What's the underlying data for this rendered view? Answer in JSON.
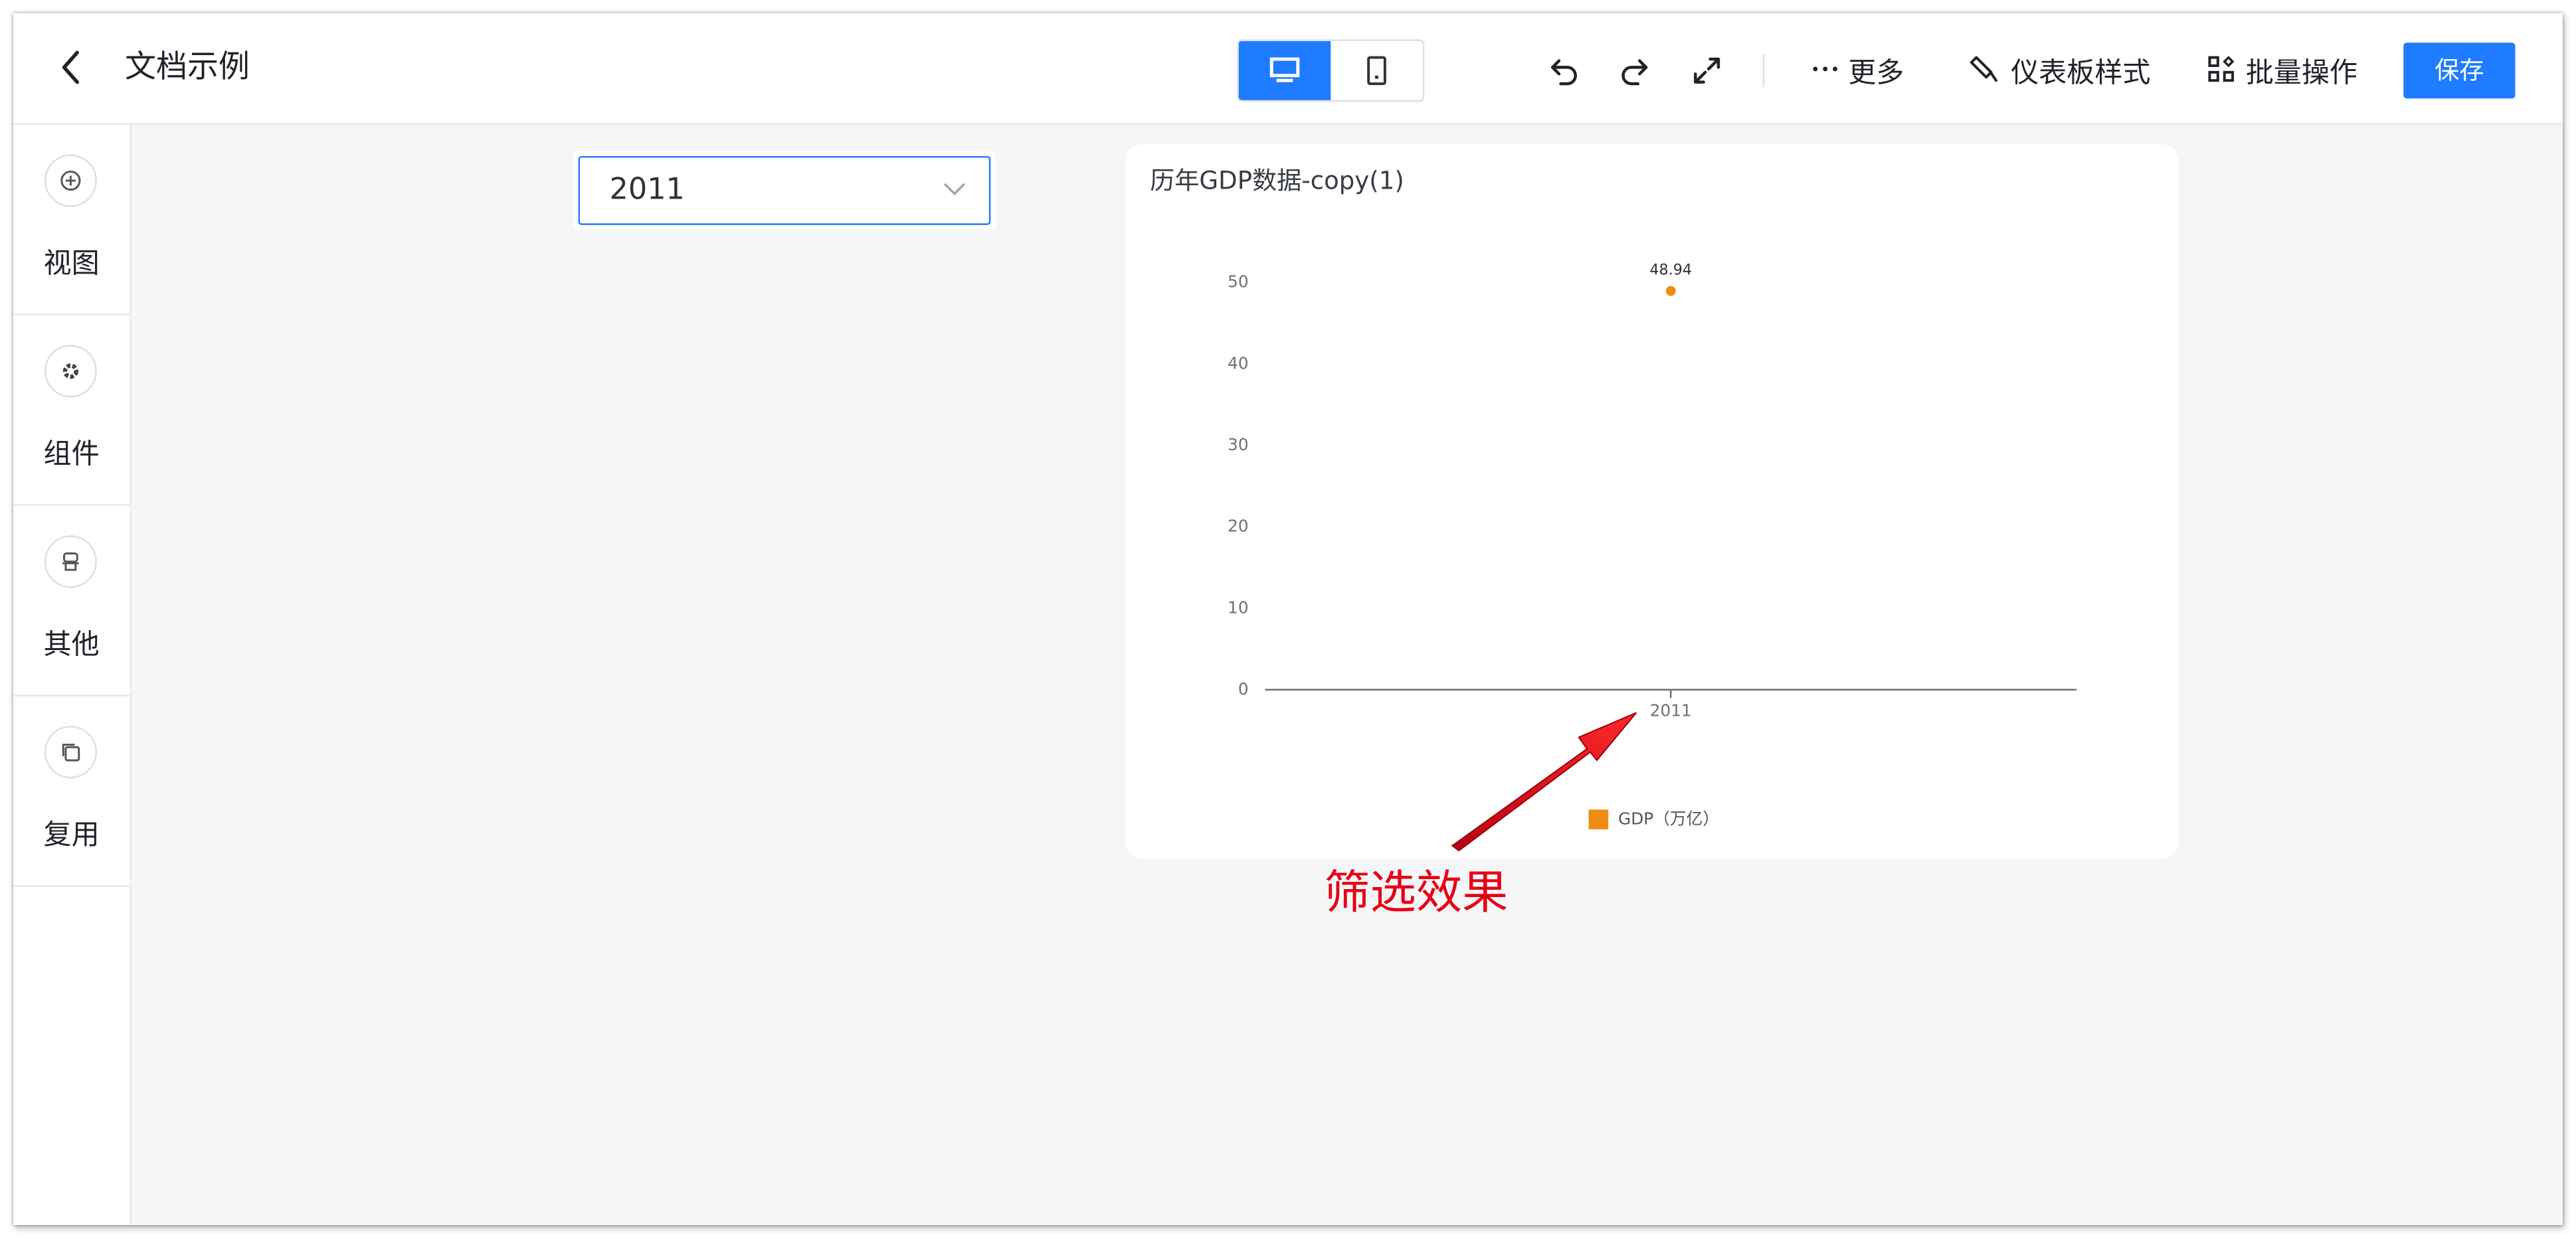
{
  "header": {
    "title": "文档示例",
    "more_label": "更多",
    "dashboard_style_label": "仪表板样式",
    "batch_label": "批量操作",
    "save_label": "保存"
  },
  "sidebar": {
    "items": [
      {
        "label": "视图",
        "icon": "plus-circle-icon"
      },
      {
        "label": "组件",
        "icon": "gear-icon"
      },
      {
        "label": "其他",
        "icon": "stamp-icon"
      },
      {
        "label": "复用",
        "icon": "copy-icon"
      }
    ]
  },
  "filter": {
    "selected": "2011"
  },
  "chart": {
    "title": "历年GDP数据-copy(1)"
  },
  "chart_data": {
    "type": "scatter",
    "categories": [
      "2011"
    ],
    "series": [
      {
        "name": "GDP（万亿）",
        "values": [
          48.94
        ],
        "color": "#ee8c13"
      }
    ],
    "data_labels": [
      "48.94"
    ],
    "y_ticks": [
      "0",
      "10",
      "20",
      "30",
      "40",
      "50"
    ],
    "ylim": [
      0,
      52.4
    ],
    "grid": false,
    "legend_position": "bottom-center"
  },
  "annotation": {
    "text": "筛选效果",
    "color": "#e60012"
  },
  "colors": {
    "accent": "#1f7bff",
    "series": "#ee8c13"
  }
}
